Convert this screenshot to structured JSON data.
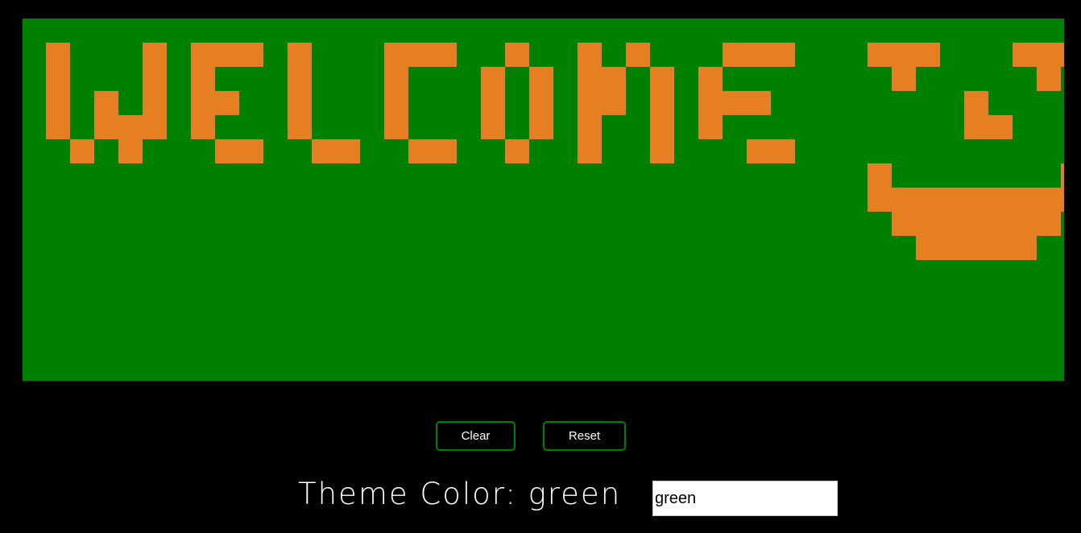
{
  "board": {
    "background_color": "#008000",
    "pixel_color": "#e67e22"
  },
  "buttons": {
    "clear_label": "Clear",
    "reset_label": "Reset",
    "border_color": "#008000"
  },
  "theme": {
    "label_prefix": "Theme Color: ",
    "current_color": "green",
    "input_value": "green"
  }
}
